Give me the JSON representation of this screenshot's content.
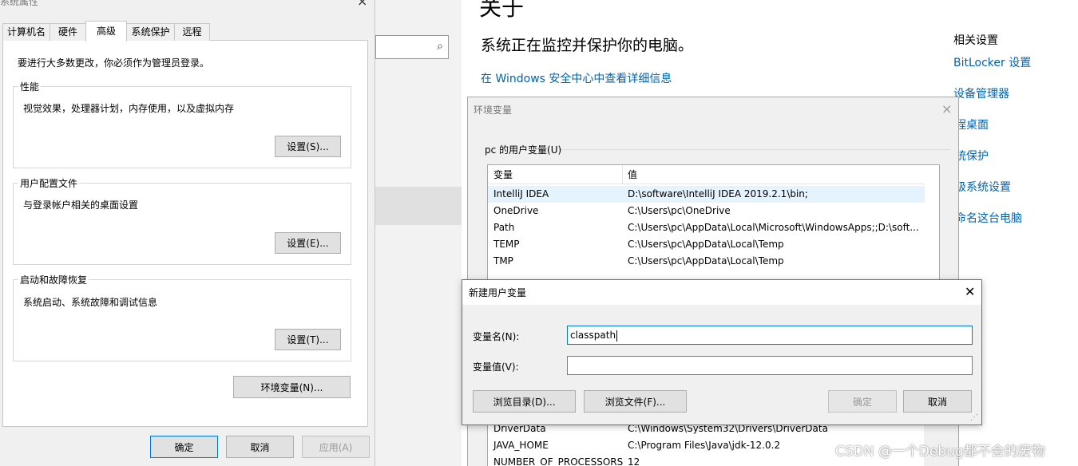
{
  "settings": {
    "title": "关于",
    "subtitle": "系统正在监控并保护你的电脑。",
    "security_link": "在 Windows 安全中心中查看详细信息",
    "search_icon": "search-icon",
    "related": {
      "heading": "相关设置",
      "links": [
        "BitLocker 设置",
        "设备管理器",
        "远程桌面",
        "系统保护",
        "高级系统设置",
        "重命名这台电脑"
      ]
    }
  },
  "system_properties": {
    "title": "系统属性",
    "close_glyph": "×",
    "tabs": [
      "计算机名",
      "硬件",
      "高级",
      "系统保护",
      "远程"
    ],
    "admin_note": "要进行大多数更改，你必须作为管理员登录。",
    "groups": [
      {
        "title": "性能",
        "desc": "视觉效果，处理器计划，内存使用，以及虚拟内存",
        "button": "设置(S)..."
      },
      {
        "title": "用户配置文件",
        "desc": "与登录帐户相关的桌面设置",
        "button": "设置(E)..."
      },
      {
        "title": "启动和故障恢复",
        "desc": "系统启动、系统故障和调试信息",
        "button": "设置(T)..."
      }
    ],
    "env_button": "环境变量(N)...",
    "ok": "确定",
    "cancel": "取消",
    "apply": "应用(A)"
  },
  "env_vars": {
    "title": "环境变量",
    "close_glyph": "×",
    "user_section": "pc 的用户变量(U)",
    "col_var": "变量",
    "col_value": "值",
    "user_rows": [
      {
        "name": "IntelliJ IDEA",
        "value": "D:\\software\\IntelliJ IDEA 2019.2.1\\bin;"
      },
      {
        "name": "OneDrive",
        "value": "C:\\Users\\pc\\OneDrive"
      },
      {
        "name": "Path",
        "value": "C:\\Users\\pc\\AppData\\Local\\Microsoft\\WindowsApps;;D:\\soft..."
      },
      {
        "name": "TEMP",
        "value": "C:\\Users\\pc\\AppData\\Local\\Temp"
      },
      {
        "name": "TMP",
        "value": "C:\\Users\\pc\\AppData\\Local\\Temp"
      }
    ],
    "system_rows": [
      {
        "name": "DriverData",
        "value": "C:\\Windows\\System32\\Drivers\\DriverData"
      },
      {
        "name": "JAVA_HOME",
        "value": "C:\\Program Files\\Java\\jdk-12.0.2"
      },
      {
        "name": "NUMBER_OF_PROCESSORS",
        "value": "12"
      }
    ]
  },
  "new_var": {
    "title": "新建用户变量",
    "close_glyph": "✕",
    "name_label": "变量名(N):",
    "value_label": "变量值(V):",
    "name_value": "classpath",
    "value_value": "",
    "browse_dir": "浏览目录(D)...",
    "browse_file": "浏览文件(F)...",
    "ok": "确定",
    "cancel": "取消",
    "grip_glyph": "⋰"
  },
  "watermark": "CSDN @一个Debug都不会的废物"
}
